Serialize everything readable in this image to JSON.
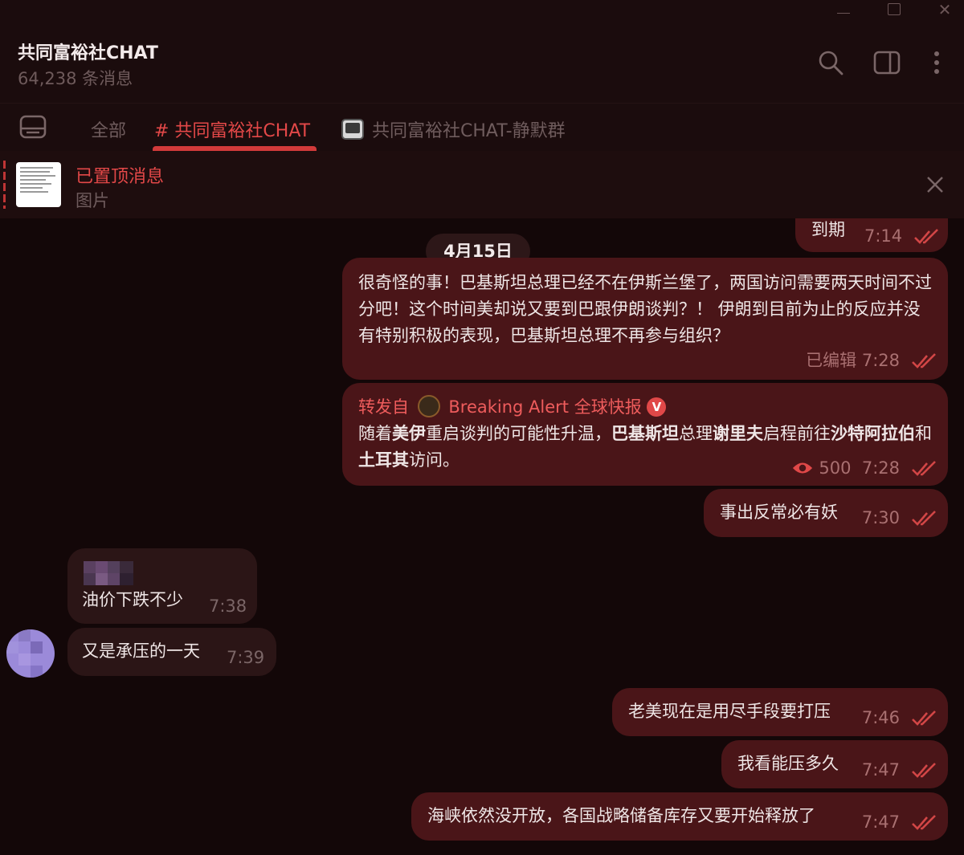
{
  "window": {
    "minimize": "—",
    "maximize": "▢",
    "close": "✕"
  },
  "header": {
    "title": "共同富裕社CHAT",
    "subtitle": "64,238 条消息",
    "icons": [
      "search-icon",
      "side-panel-icon",
      "more-vertical-icon"
    ]
  },
  "tabs": {
    "all": "全部",
    "active": "# 共同富裕社CHAT",
    "silent": "共同富裕社CHAT-静默群"
  },
  "pinned": {
    "title": "已置顶消息",
    "subtitle": "图片"
  },
  "date_divider": "4月15日",
  "messages": [
    {
      "id": "m0",
      "text": "到期",
      "time": "7:14"
    },
    {
      "id": "m1",
      "text": "很奇怪的事！巴基斯坦总理已经不在伊斯兰堡了，两国访问需要两天时间不过分吧！这个时间美却说又要到巴跟伊朗谈判？！ 伊朗到目前为止的反应并没有特别积极的表现，巴基斯坦总理不再参与组织？",
      "edited": "已编辑",
      "time": "7:28"
    },
    {
      "id": "m2",
      "forward_label": "转发自",
      "forward_source": "Breaking Alert 全球快报",
      "verified": "V",
      "parts": [
        "随着",
        "美伊",
        "重启谈判的可能性升温，",
        "巴基斯坦",
        "总理",
        "谢里夫",
        "启程前往",
        "沙特阿拉伯",
        "和",
        "土耳其",
        "访问。"
      ],
      "views": "500",
      "time": "7:28"
    },
    {
      "id": "m3",
      "text": "事出反常必有妖",
      "time": "7:30"
    },
    {
      "id": "m4",
      "text": "油价下跌不少",
      "time": "7:38"
    },
    {
      "id": "m5",
      "text": "又是承压的一天",
      "time": "7:39"
    },
    {
      "id": "m6",
      "text": "老美现在是用尽手段要打压",
      "time": "7:46"
    },
    {
      "id": "m7",
      "text": "我看能压多久",
      "time": "7:47"
    },
    {
      "id": "m8",
      "text": "海峡依然没开放，各国战略储备库存又要开始释放了",
      "time": "7:47"
    }
  ],
  "colors": {
    "background": "#130708",
    "outgoing_bubble": "#4a1518",
    "incoming_bubble": "#2b1516",
    "accent": "#e34848"
  }
}
